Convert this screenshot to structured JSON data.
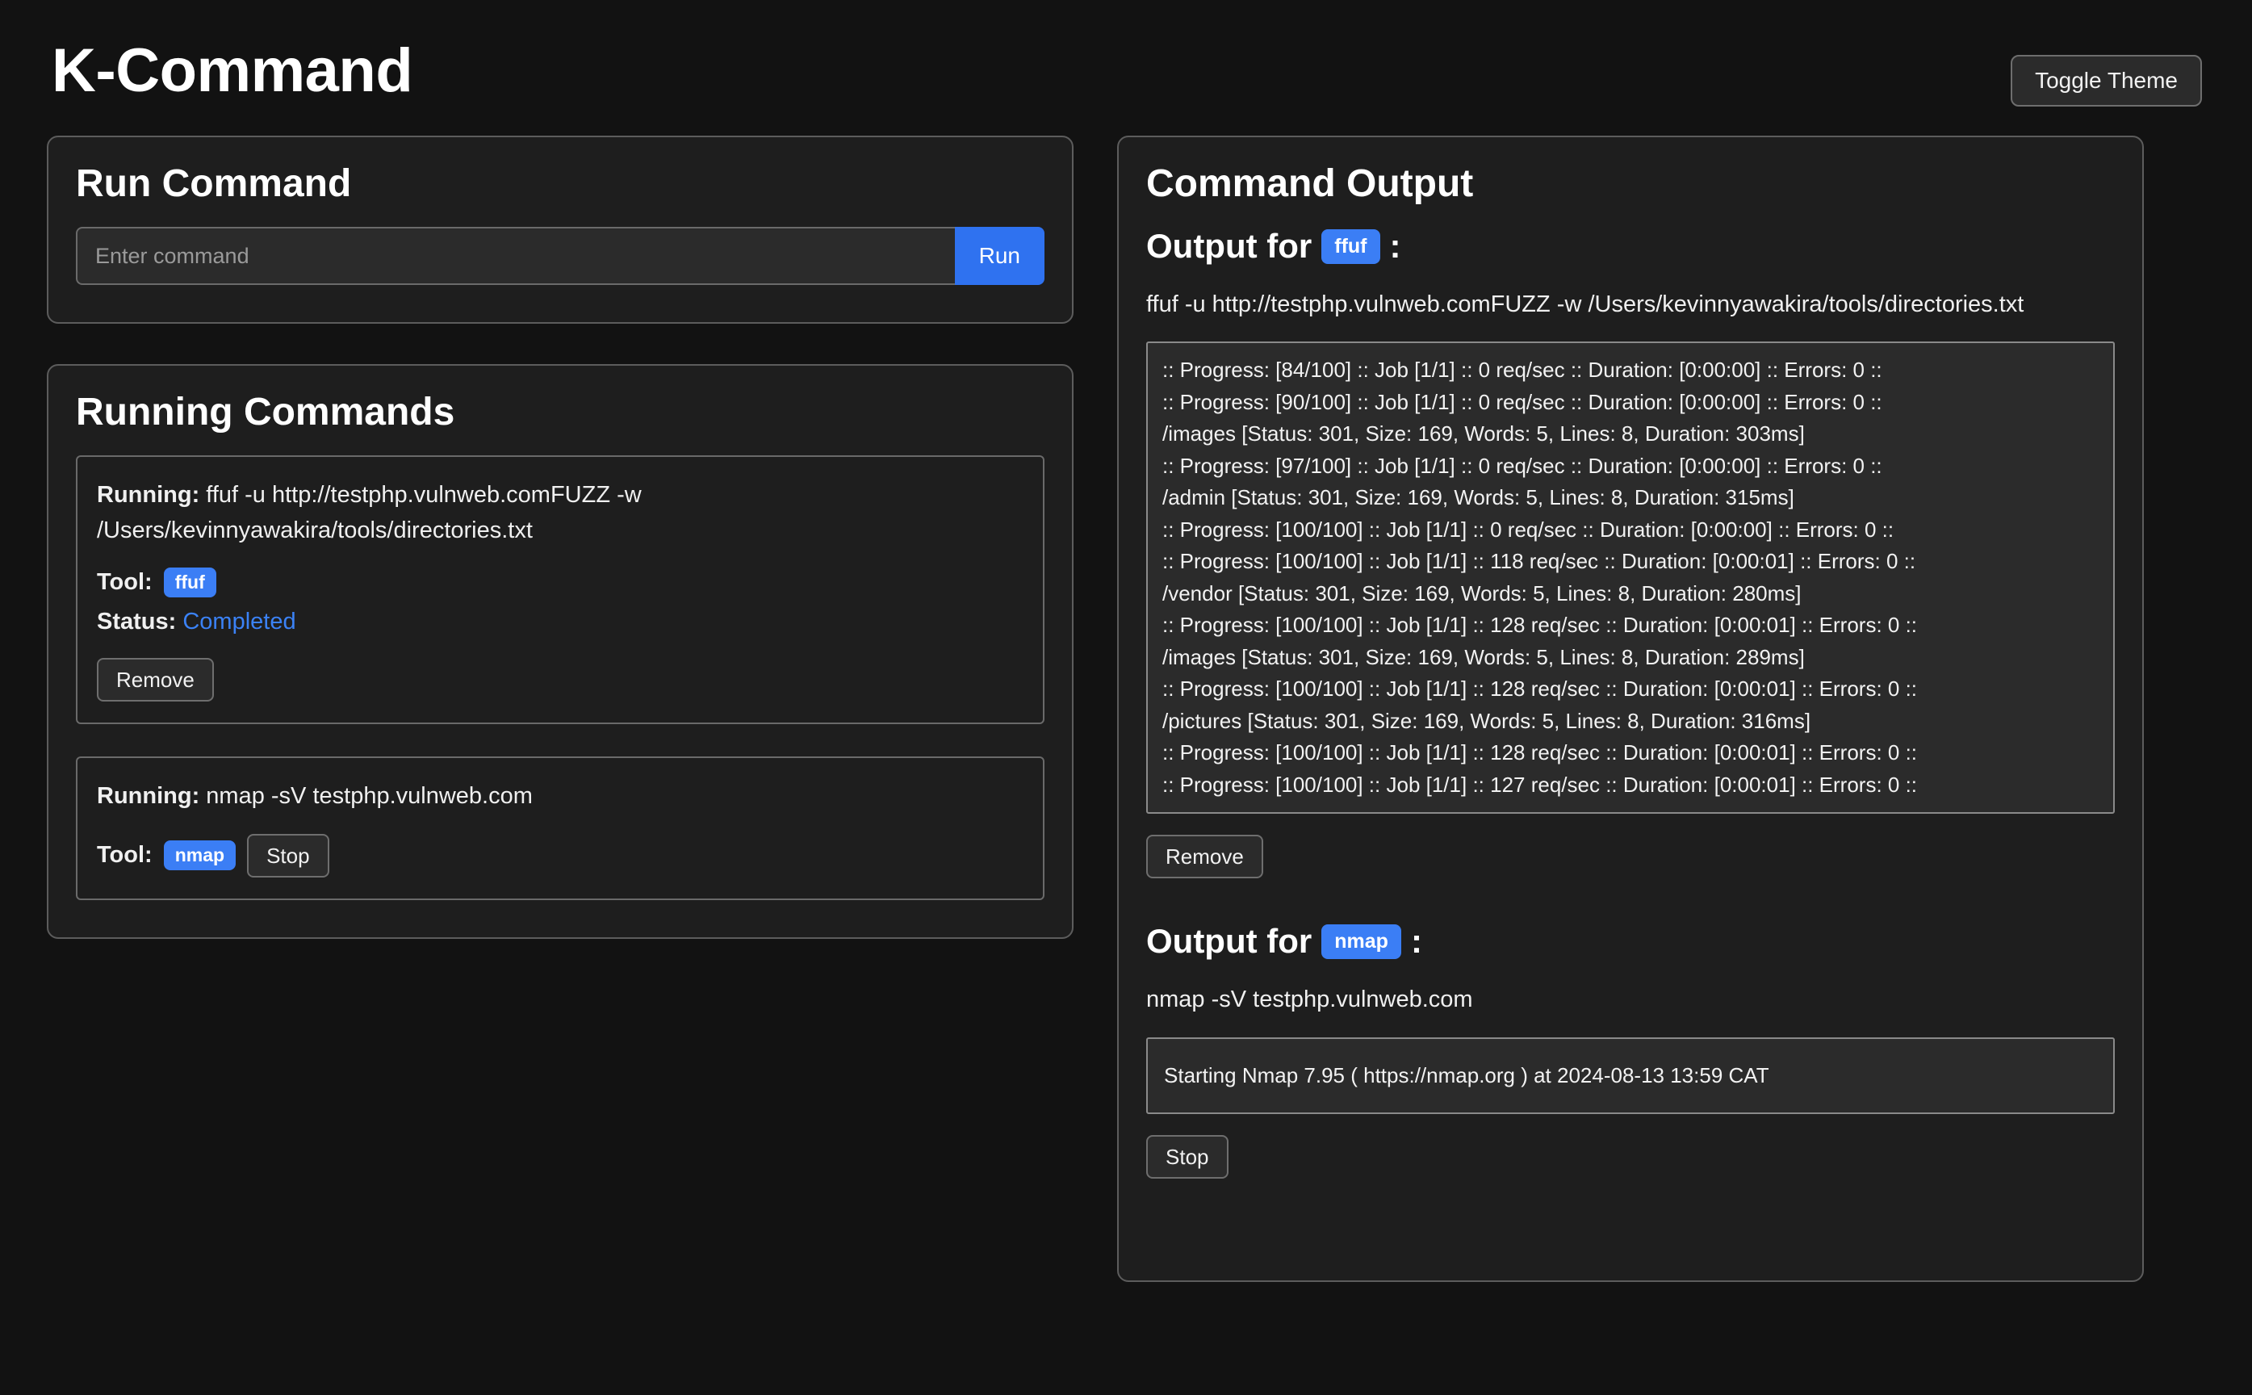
{
  "header": {
    "title": "K-Command",
    "toggle_theme_label": "Toggle Theme"
  },
  "colors": {
    "page_bg": "#121212",
    "panel_bg": "#1e1e1e",
    "panel_border": "#5c5c5c",
    "accent_blue": "#3b7ef5",
    "run_button_blue": "#2f72f0",
    "status_completed": "#3b82f6",
    "terminal_bg": "#2b2b2b"
  },
  "run_command": {
    "title": "Run Command",
    "input_placeholder": "Enter command",
    "input_value": "",
    "run_label": "Run"
  },
  "running_commands": {
    "title": "Running Commands",
    "items": [
      {
        "running_label": "Running:",
        "command": "ffuf -u http://testphp.vulnweb.comFUZZ -w /Users/kevinnyawakira/tools/directories.txt",
        "tool_label": "Tool:",
        "tool": "ffuf",
        "status_label": "Status:",
        "status": "Completed",
        "action_label": "Remove"
      },
      {
        "running_label": "Running:",
        "command": "nmap -sV testphp.vulnweb.com",
        "tool_label": "Tool:",
        "tool": "nmap",
        "status_label": "",
        "status": "",
        "action_label": "Stop"
      }
    ]
  },
  "command_output": {
    "title": "Command Output",
    "sections": [
      {
        "heading_prefix": "Output for",
        "tool": "ffuf",
        "heading_suffix": ":",
        "command": "ffuf -u http://testphp.vulnweb.comFUZZ -w /Users/kevinnyawakira/tools/directories.txt",
        "lines": [
          ":: Progress: [84/100] :: Job [1/1] :: 0 req/sec :: Duration: [0:00:00] :: Errors: 0 ::",
          ":: Progress: [90/100] :: Job [1/1] :: 0 req/sec :: Duration: [0:00:00] :: Errors: 0 ::",
          "/images [Status: 301, Size: 169, Words: 5, Lines: 8, Duration: 303ms]",
          ":: Progress: [97/100] :: Job [1/1] :: 0 req/sec :: Duration: [0:00:00] :: Errors: 0 ::",
          "/admin [Status: 301, Size: 169, Words: 5, Lines: 8, Duration: 315ms]",
          ":: Progress: [100/100] :: Job [1/1] :: 0 req/sec :: Duration: [0:00:00] :: Errors: 0 ::",
          ":: Progress: [100/100] :: Job [1/1] :: 118 req/sec :: Duration: [0:00:01] :: Errors: 0 ::",
          "/vendor [Status: 301, Size: 169, Words: 5, Lines: 8, Duration: 280ms]",
          ":: Progress: [100/100] :: Job [1/1] :: 128 req/sec :: Duration: [0:00:01] :: Errors: 0 ::",
          "/images [Status: 301, Size: 169, Words: 5, Lines: 8, Duration: 289ms]",
          ":: Progress: [100/100] :: Job [1/1] :: 128 req/sec :: Duration: [0:00:01] :: Errors: 0 ::",
          "/pictures [Status: 301, Size: 169, Words: 5, Lines: 8, Duration: 316ms]",
          ":: Progress: [100/100] :: Job [1/1] :: 128 req/sec :: Duration: [0:00:01] :: Errors: 0 ::",
          ":: Progress: [100/100] :: Job [1/1] :: 127 req/sec :: Duration: [0:00:01] :: Errors: 0 ::"
        ],
        "action_label": "Remove"
      },
      {
        "heading_prefix": "Output for",
        "tool": "nmap",
        "heading_suffix": ":",
        "command": "nmap -sV testphp.vulnweb.com",
        "lines": [
          "Starting Nmap 7.95 ( https://nmap.org ) at 2024-08-13 13:59 CAT"
        ],
        "action_label": "Stop"
      }
    ]
  }
}
